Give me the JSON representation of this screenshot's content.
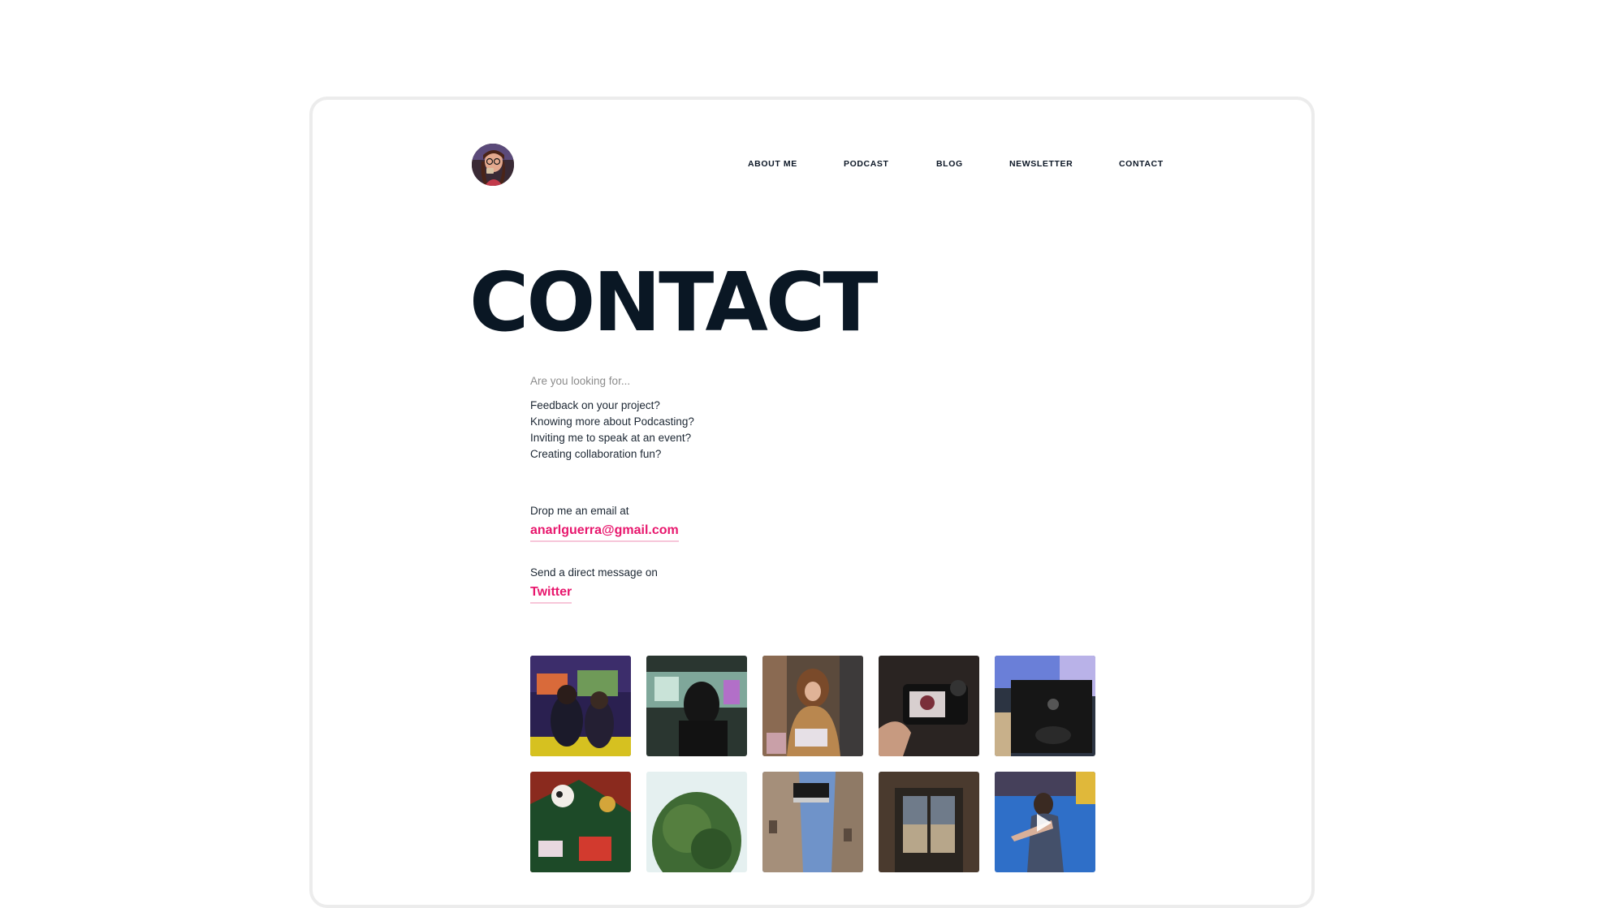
{
  "nav": {
    "items": [
      {
        "label": "ABOUT ME"
      },
      {
        "label": "PODCAST"
      },
      {
        "label": "BLOG"
      },
      {
        "label": "NEWSLETTER"
      },
      {
        "label": "CONTACT"
      }
    ]
  },
  "page": {
    "title": "CONTACT"
  },
  "intro": {
    "lead": "Are you looking for...",
    "questions": [
      "Feedback on your project?",
      "Knowing more about Podcasting?",
      "Inviting me to speak at an event?",
      "Creating collaboration fun?"
    ]
  },
  "email": {
    "label": "Drop me an email at",
    "link": "anarlguerra@gmail.com"
  },
  "twitter": {
    "label": "Send a direct message on",
    "link": "Twitter"
  },
  "colors": {
    "accent": "#e8176d",
    "accent_underline": "#f7c6d9",
    "text_dark": "#0a1724",
    "muted": "#8c8c8c",
    "frame_border": "#ececec"
  },
  "gallery": {
    "photos": [
      {
        "subject": "gaming-event-crowd",
        "video": false
      },
      {
        "subject": "dark-room-silhouette",
        "video": false
      },
      {
        "subject": "woman-reading-book",
        "video": false
      },
      {
        "subject": "camera-screen-selfie",
        "video": false
      },
      {
        "subject": "xbox-controller",
        "video": false
      },
      {
        "subject": "christmas-tree-ornaments",
        "video": false
      },
      {
        "subject": "tree-against-sky",
        "video": false
      },
      {
        "subject": "street-building-sign",
        "video": false
      },
      {
        "subject": "doorway-view",
        "video": false
      },
      {
        "subject": "person-on-blue-floor",
        "video": true
      }
    ]
  }
}
